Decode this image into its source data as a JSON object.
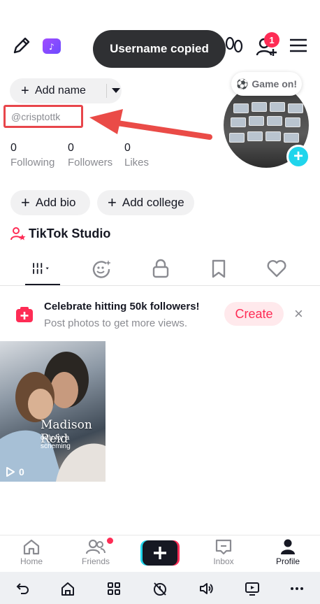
{
  "toast": {
    "text": "Username copied"
  },
  "top_bar": {
    "notification_count": "1"
  },
  "profile": {
    "add_name_label": "Add name",
    "username": "@crisptottk",
    "stats": [
      {
        "value": "0",
        "label": "Following"
      },
      {
        "value": "0",
        "label": "Followers"
      },
      {
        "value": "0",
        "label": "Likes"
      }
    ],
    "avatar_bubble": "Game on!",
    "add_bio_label": "Add bio",
    "add_college_label": "Add college",
    "studio_label": "TikTok Studio"
  },
  "tabs": [
    "videos-grid",
    "reposts",
    "private",
    "bookmarks",
    "likes"
  ],
  "promo": {
    "title": "Celebrate hitting 50k followers!",
    "subtitle": "Post photos to get more views.",
    "button": "Create"
  },
  "post": {
    "title": "Madison Reid",
    "subtitle": "only for a scheming",
    "views": "0"
  },
  "bottom_nav": {
    "items": [
      "Home",
      "Friends",
      "Inbox",
      "Profile"
    ],
    "active": "Profile"
  },
  "colors": {
    "accent": "#fe2c55",
    "cyan": "#20d5ec",
    "highlight_box": "#e8464b",
    "arrow": "#ea4b47"
  }
}
